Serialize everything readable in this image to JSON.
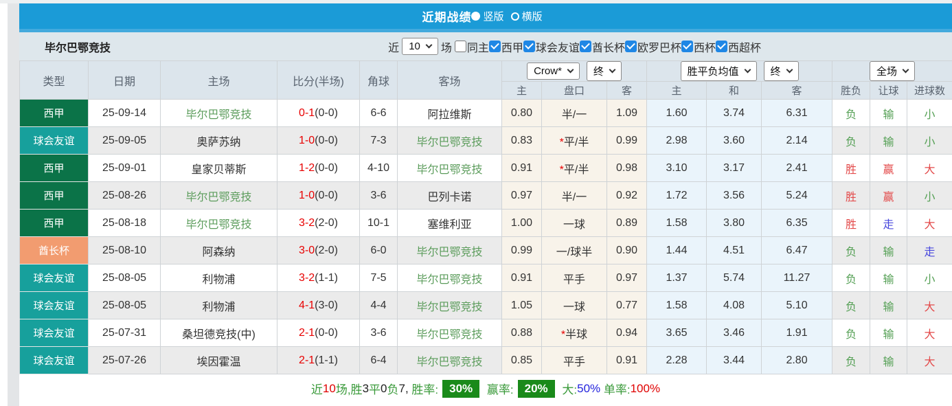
{
  "header": {
    "title": "近期战绩",
    "radios": [
      {
        "label": "竖版",
        "selected": true
      },
      {
        "label": "横版",
        "selected": false
      }
    ]
  },
  "filter": {
    "team": "毕尔巴鄂竞技",
    "near_label": "近",
    "rounds_value": "10",
    "rounds_suffix": "场",
    "checkboxes": [
      {
        "label": "同主",
        "checked": false
      },
      {
        "label": "西甲",
        "checked": true
      },
      {
        "label": "球会友谊",
        "checked": true
      },
      {
        "label": "酋长杯",
        "checked": true
      },
      {
        "label": "欧罗巴杯",
        "checked": true
      },
      {
        "label": "西杯",
        "checked": true
      },
      {
        "label": "西超杯",
        "checked": true
      }
    ]
  },
  "table": {
    "static_headers": [
      "类型",
      "日期",
      "主场",
      "比分(半场)",
      "角球",
      "客场"
    ],
    "selects": {
      "company": "Crow*",
      "company_time": "终",
      "avg": "胜平负均值",
      "avg_time": "终",
      "period": "全场"
    },
    "sub_headers": [
      "主",
      "盘口",
      "客",
      "主",
      "和",
      "客",
      "胜负",
      "让球",
      "进球数"
    ],
    "rows": [
      {
        "league": "西甲",
        "date": "25-09-14",
        "home": "毕尔巴鄂竞技",
        "score": "0-1",
        "half": "(0-0)",
        "corners": "6-6",
        "away": "阿拉维斯",
        "odds": [
          "0.80",
          "半/一",
          "1.09"
        ],
        "avg": [
          "1.60",
          "3.74",
          "6.31"
        ],
        "results": [
          "负",
          "输",
          "小"
        ]
      },
      {
        "league": "球会友谊",
        "date": "25-09-05",
        "home": "奥萨苏纳",
        "score": "1-0",
        "half": "(0-0)",
        "corners": "7-3",
        "away": "毕尔巴鄂竞技",
        "odds": [
          "0.83",
          "*平/半",
          "0.99"
        ],
        "avg": [
          "2.98",
          "3.60",
          "2.14"
        ],
        "results": [
          "负",
          "输",
          "小"
        ]
      },
      {
        "league": "西甲",
        "date": "25-09-01",
        "home": "皇家贝蒂斯",
        "score": "1-2",
        "half": "(0-0)",
        "corners": "4-10",
        "away": "毕尔巴鄂竞技",
        "odds": [
          "0.91",
          "*平/半",
          "0.98"
        ],
        "avg": [
          "3.10",
          "3.17",
          "2.41"
        ],
        "results": [
          "胜",
          "赢",
          "大"
        ]
      },
      {
        "league": "西甲",
        "date": "25-08-26",
        "home": "毕尔巴鄂竞技",
        "score": "1-0",
        "half": "(0-0)",
        "corners": "3-6",
        "away": "巴列卡诺",
        "odds": [
          "0.97",
          "半/一",
          "0.92"
        ],
        "avg": [
          "1.72",
          "3.56",
          "5.24"
        ],
        "results": [
          "胜",
          "赢",
          "小"
        ]
      },
      {
        "league": "西甲",
        "date": "25-08-18",
        "home": "毕尔巴鄂竞技",
        "score": "3-2",
        "half": "(2-0)",
        "corners": "10-1",
        "away": "塞维利亚",
        "odds": [
          "1.00",
          "一球",
          "0.89"
        ],
        "avg": [
          "1.58",
          "3.80",
          "6.35"
        ],
        "results": [
          "胜",
          "走",
          "大"
        ]
      },
      {
        "league": "酋长杯",
        "date": "25-08-10",
        "home": "阿森纳",
        "score": "3-0",
        "half": "(2-0)",
        "corners": "6-0",
        "away": "毕尔巴鄂竞技",
        "odds": [
          "0.99",
          "一/球半",
          "0.90"
        ],
        "avg": [
          "1.44",
          "4.51",
          "6.47"
        ],
        "results": [
          "负",
          "输",
          "走"
        ]
      },
      {
        "league": "球会友谊",
        "date": "25-08-05",
        "home": "利物浦",
        "score": "3-2",
        "half": "(1-1)",
        "corners": "7-5",
        "away": "毕尔巴鄂竞技",
        "odds": [
          "0.91",
          "平手",
          "0.97"
        ],
        "avg": [
          "1.37",
          "5.74",
          "11.27"
        ],
        "results": [
          "负",
          "输",
          "小"
        ]
      },
      {
        "league": "球会友谊",
        "date": "25-08-05",
        "home": "利物浦",
        "score": "4-1",
        "half": "(3-0)",
        "corners": "4-4",
        "away": "毕尔巴鄂竞技",
        "odds": [
          "1.05",
          "一球",
          "0.77"
        ],
        "avg": [
          "1.58",
          "4.08",
          "5.10"
        ],
        "results": [
          "负",
          "输",
          "大"
        ]
      },
      {
        "league": "球会友谊",
        "date": "25-07-31",
        "home": "桑坦德竞技(中)",
        "score": "2-1",
        "half": "(0-0)",
        "corners": "3-6",
        "away": "毕尔巴鄂竞技",
        "odds": [
          "0.88",
          "*半球",
          "0.94"
        ],
        "avg": [
          "3.65",
          "3.46",
          "1.91"
        ],
        "results": [
          "负",
          "输",
          "大"
        ]
      },
      {
        "league": "球会友谊",
        "date": "25-07-26",
        "home": "埃因霍温",
        "score": "2-1",
        "half": "(1-1)",
        "corners": "6-4",
        "away": "毕尔巴鄂竞技",
        "odds": [
          "0.85",
          "平手",
          "0.91"
        ],
        "avg": [
          "2.28",
          "3.44",
          "2.80"
        ],
        "results": [
          "负",
          "输",
          "大"
        ]
      }
    ]
  },
  "footer": {
    "segments": [
      {
        "t": "近",
        "c": "g"
      },
      {
        "t": "10",
        "c": "r"
      },
      {
        "t": "场,胜",
        "c": "g"
      },
      {
        "t": "3",
        "c": "k"
      },
      {
        "t": "平",
        "c": "g"
      },
      {
        "t": "0",
        "c": "k"
      },
      {
        "t": "负",
        "c": "g"
      },
      {
        "t": "7, ",
        "c": "k"
      },
      {
        "t": "胜率:",
        "c": "g"
      },
      {
        "t": "30%",
        "c": "badge"
      },
      {
        "t": " 赢率:",
        "c": "g"
      },
      {
        "t": "20%",
        "c": "badge"
      },
      {
        "t": " 大:",
        "c": "g"
      },
      {
        "t": "50%",
        "c": "b"
      },
      {
        "t": " 单率:",
        "c": "g"
      },
      {
        "t": "100%",
        "c": "r"
      }
    ]
  },
  "colors": {
    "league": {
      "西甲": "#0b7348",
      "球会友谊": "#17a09c",
      "酋长杯": "#f29c70"
    },
    "outcome": {
      "胜": "#e34a4a",
      "负": "#55a055",
      "赢": "#e34a4a",
      "输": "#55a055",
      "走": "#4848dd",
      "大": "#e34a4a",
      "小": "#55a055"
    },
    "subject_team": "#5b9c5b",
    "score_red": "#e80000",
    "badge_bg": "#1a8a1a",
    "titlebar_blue": "#1b9bd7"
  }
}
